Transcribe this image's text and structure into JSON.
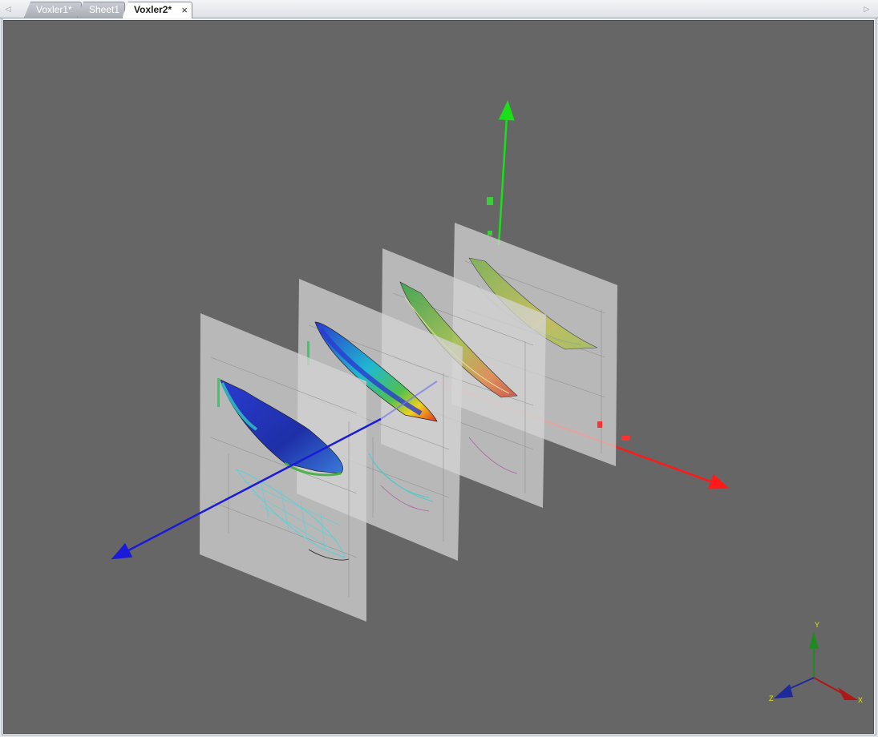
{
  "tabs": [
    {
      "label": "Voxler1*"
    },
    {
      "label": "Sheet1"
    },
    {
      "label": "Voxler2*",
      "close": "×"
    }
  ],
  "nav": {
    "left": "◁",
    "right": "▷"
  },
  "axes": {
    "x_color": "#ff1a1a",
    "y_color": "#19e019",
    "z_color": "#1a1ad9"
  },
  "triad": {
    "x_label": "X",
    "y_label": "Y",
    "z_label": "Z",
    "x_color": "#b01818",
    "y_color": "#1f8a1f",
    "z_color": "#1f2a9a",
    "label_color": "#e6e600"
  },
  "colors": {
    "background": "#666666",
    "slice": "#cfcfcf"
  }
}
